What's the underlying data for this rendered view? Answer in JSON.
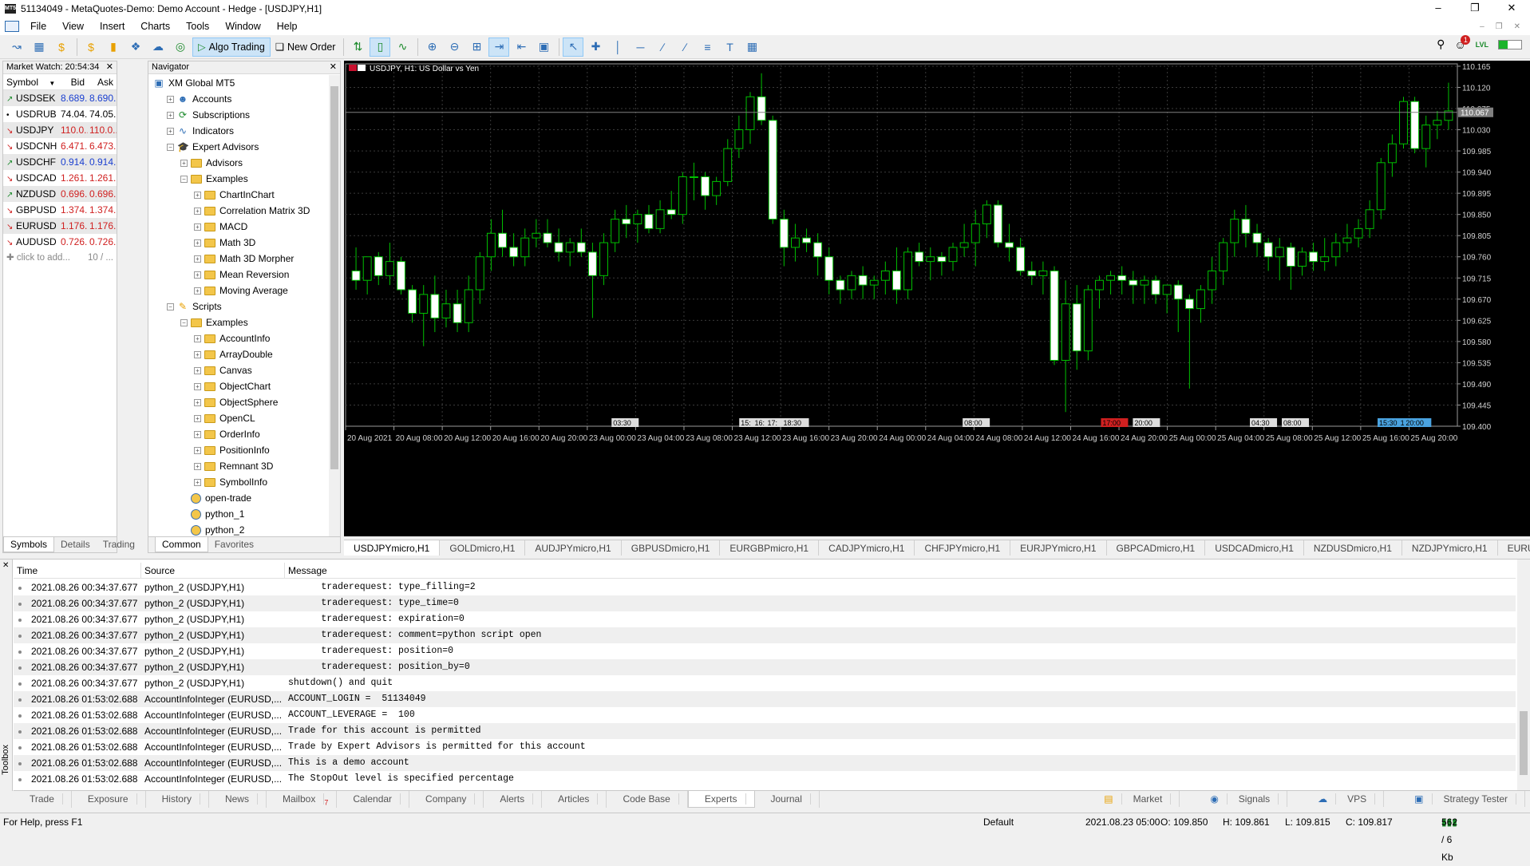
{
  "window": {
    "title": "51134049 - MetaQuotes-Demo: Demo Account - Hedge - [USDJPY,H1]",
    "app_icon": "MT5"
  },
  "menu": [
    "File",
    "View",
    "Insert",
    "Charts",
    "Tools",
    "Window",
    "Help"
  ],
  "toolbar": {
    "algo_trading": "Algo Trading",
    "new_order": "New Order",
    "notification_count": "1",
    "level_badge": "LVL"
  },
  "market_watch": {
    "title": "Market Watch: 20:54:34",
    "headers": {
      "symbol": "Symbol",
      "bid": "Bid",
      "ask": "Ask"
    },
    "rows": [
      {
        "symbol": "USDSEK",
        "bid": "8.689...",
        "ask": "8.690...",
        "dir": "up",
        "color": "blue"
      },
      {
        "symbol": "USDRUB",
        "bid": "74.04...",
        "ask": "74.05...",
        "dir": "flat",
        "color": "black"
      },
      {
        "symbol": "USDJPY",
        "bid": "110.0...",
        "ask": "110.0...",
        "dir": "down",
        "color": "red"
      },
      {
        "symbol": "USDCNH",
        "bid": "6.471...",
        "ask": "6.473...",
        "dir": "down",
        "color": "red"
      },
      {
        "symbol": "USDCHF",
        "bid": "0.914...",
        "ask": "0.914...",
        "dir": "up",
        "color": "blue"
      },
      {
        "symbol": "USDCAD",
        "bid": "1.261...",
        "ask": "1.261...",
        "dir": "down",
        "color": "red"
      },
      {
        "symbol": "NZDUSD",
        "bid": "0.696...",
        "ask": "0.696...",
        "dir": "up",
        "color": "red"
      },
      {
        "symbol": "GBPUSD",
        "bid": "1.374...",
        "ask": "1.374...",
        "dir": "down",
        "color": "red"
      },
      {
        "symbol": "EURUSD",
        "bid": "1.176...",
        "ask": "1.176...",
        "dir": "down",
        "color": "red"
      },
      {
        "symbol": "AUDUSD",
        "bid": "0.726...",
        "ask": "0.726...",
        "dir": "down",
        "color": "red"
      }
    ],
    "add_text": "click to add...",
    "count_text": "10 / ...",
    "tabs": [
      "Symbols",
      "Details",
      "Trading"
    ]
  },
  "navigator": {
    "title": "Navigator",
    "items": [
      {
        "label": "XM Global MT5",
        "level": 0,
        "kind": "root"
      },
      {
        "label": "Accounts",
        "level": 1,
        "kind": "accounts",
        "expander": "+"
      },
      {
        "label": "Subscriptions",
        "level": 1,
        "kind": "subs",
        "expander": "+"
      },
      {
        "label": "Indicators",
        "level": 1,
        "kind": "ind",
        "expander": "+"
      },
      {
        "label": "Expert Advisors",
        "level": 1,
        "kind": "ea",
        "expander": "-"
      },
      {
        "label": "Advisors",
        "level": 2,
        "kind": "folder",
        "expander": "+"
      },
      {
        "label": "Examples",
        "level": 2,
        "kind": "folder",
        "expander": "-"
      },
      {
        "label": "ChartInChart",
        "level": 3,
        "kind": "folder",
        "expander": "+"
      },
      {
        "label": "Correlation Matrix 3D",
        "level": 3,
        "kind": "folder",
        "expander": "+"
      },
      {
        "label": "MACD",
        "level": 3,
        "kind": "folder",
        "expander": "+"
      },
      {
        "label": "Math 3D",
        "level": 3,
        "kind": "folder",
        "expander": "+"
      },
      {
        "label": "Math 3D Morpher",
        "level": 3,
        "kind": "folder",
        "expander": "+"
      },
      {
        "label": "Mean Reversion",
        "level": 3,
        "kind": "folder",
        "expander": "+"
      },
      {
        "label": "Moving Average",
        "level": 3,
        "kind": "folder",
        "expander": "+"
      },
      {
        "label": "Scripts",
        "level": 1,
        "kind": "scripts",
        "expander": "-"
      },
      {
        "label": "Examples",
        "level": 2,
        "kind": "folder",
        "expander": "-"
      },
      {
        "label": "AccountInfo",
        "level": 3,
        "kind": "folder",
        "expander": "+"
      },
      {
        "label": "ArrayDouble",
        "level": 3,
        "kind": "folder",
        "expander": "+"
      },
      {
        "label": "Canvas",
        "level": 3,
        "kind": "folder",
        "expander": "+"
      },
      {
        "label": "ObjectChart",
        "level": 3,
        "kind": "folder",
        "expander": "+"
      },
      {
        "label": "ObjectSphere",
        "level": 3,
        "kind": "folder",
        "expander": "+"
      },
      {
        "label": "OpenCL",
        "level": 3,
        "kind": "folder",
        "expander": "+"
      },
      {
        "label": "OrderInfo",
        "level": 3,
        "kind": "folder",
        "expander": "+"
      },
      {
        "label": "PositionInfo",
        "level": 3,
        "kind": "folder",
        "expander": "+"
      },
      {
        "label": "Remnant 3D",
        "level": 3,
        "kind": "folder",
        "expander": "+"
      },
      {
        "label": "SymbolInfo",
        "level": 3,
        "kind": "folder",
        "expander": "+"
      },
      {
        "label": "open-trade",
        "level": 2,
        "kind": "python"
      },
      {
        "label": "python_1",
        "level": 2,
        "kind": "python"
      },
      {
        "label": "python_2",
        "level": 2,
        "kind": "python"
      }
    ],
    "tabs": [
      "Common",
      "Favorites"
    ]
  },
  "chart": {
    "label": "USDJPY, H1:  US Dollar vs Yen",
    "price_labels": [
      "110.165",
      "110.120",
      "110.075",
      "110.030",
      "109.985",
      "109.940",
      "109.895",
      "109.850",
      "109.805",
      "109.760",
      "109.715",
      "109.670",
      "109.625",
      "109.580",
      "109.535",
      "109.490",
      "109.445",
      "109.400"
    ],
    "current_price": "110.067",
    "time_labels": [
      "20 Aug 2021",
      "20 Aug 08:00",
      "20 Aug 12:00",
      "20 Aug 16:00",
      "20 Aug 20:00",
      "23 Aug 00:00",
      "23 Aug 04:00",
      "23 Aug 08:00",
      "23 Aug 12:00",
      "23 Aug 16:00",
      "23 Aug 20:00",
      "24 Aug 00:00",
      "24 Aug 04:00",
      "24 Aug 08:00",
      "24 Aug 12:00",
      "24 Aug 16:00",
      "24 Aug 20:00",
      "25 Aug 00:00",
      "25 Aug 04:00",
      "25 Aug 08:00",
      "25 Aug 12:00",
      "25 Aug 16:00",
      "25 Aug 20:00"
    ],
    "event_markers": [
      "03:30",
      "15:",
      "16:",
      "17:",
      "18:30",
      "08:00",
      "17:00",
      "20:00",
      "04:30",
      "08:00",
      "15:30",
      "17:30",
      "20:00"
    ]
  },
  "chart_data": {
    "type": "candlestick",
    "symbol": "USDJPY",
    "timeframe": "H1",
    "ylim": [
      109.4,
      110.17
    ],
    "candles": [
      [
        109.73,
        109.78,
        109.69,
        109.71
      ],
      [
        109.71,
        109.76,
        109.68,
        109.76
      ],
      [
        109.76,
        109.77,
        109.7,
        109.72
      ],
      [
        109.72,
        109.79,
        109.7,
        109.75
      ],
      [
        109.75,
        109.76,
        109.68,
        109.69
      ],
      [
        109.69,
        109.7,
        109.62,
        109.64
      ],
      [
        109.64,
        109.7,
        109.57,
        109.68
      ],
      [
        109.68,
        109.72,
        109.6,
        109.63
      ],
      [
        109.63,
        109.69,
        109.61,
        109.66
      ],
      [
        109.66,
        109.69,
        109.6,
        109.62
      ],
      [
        109.62,
        109.72,
        109.6,
        109.69
      ],
      [
        109.69,
        109.77,
        109.66,
        109.76
      ],
      [
        109.76,
        109.84,
        109.73,
        109.81
      ],
      [
        109.81,
        109.86,
        109.76,
        109.78
      ],
      [
        109.78,
        109.81,
        109.74,
        109.76
      ],
      [
        109.76,
        109.82,
        109.74,
        109.8
      ],
      [
        109.8,
        109.84,
        109.78,
        109.81
      ],
      [
        109.81,
        109.84,
        109.78,
        109.79
      ],
      [
        109.79,
        109.82,
        109.75,
        109.77
      ],
      [
        109.77,
        109.8,
        109.74,
        109.79
      ],
      [
        109.79,
        109.82,
        109.76,
        109.77
      ],
      [
        109.77,
        109.79,
        109.63,
        109.72
      ],
      [
        109.72,
        109.81,
        109.7,
        109.79
      ],
      [
        109.79,
        109.86,
        109.77,
        109.84
      ],
      [
        109.84,
        109.87,
        109.8,
        109.83
      ],
      [
        109.83,
        109.86,
        109.79,
        109.85
      ],
      [
        109.85,
        109.87,
        109.81,
        109.82
      ],
      [
        109.82,
        109.88,
        109.81,
        109.86
      ],
      [
        109.86,
        109.9,
        109.84,
        109.85
      ],
      [
        109.85,
        109.94,
        109.83,
        109.93
      ],
      [
        109.93,
        109.96,
        109.88,
        109.93
      ],
      [
        109.93,
        109.94,
        109.86,
        109.89
      ],
      [
        109.89,
        109.93,
        109.87,
        109.92
      ],
      [
        109.92,
        110.01,
        109.91,
        109.99
      ],
      [
        109.99,
        110.06,
        109.97,
        110.03
      ],
      [
        110.03,
        110.11,
        110.0,
        110.1
      ],
      [
        110.1,
        110.15,
        110.04,
        110.05
      ],
      [
        110.05,
        110.06,
        109.83,
        109.84
      ],
      [
        109.84,
        109.86,
        109.74,
        109.78
      ],
      [
        109.78,
        109.83,
        109.75,
        109.8
      ],
      [
        109.8,
        109.82,
        109.77,
        109.79
      ],
      [
        109.79,
        109.81,
        109.72,
        109.76
      ],
      [
        109.76,
        109.78,
        109.68,
        109.71
      ],
      [
        109.71,
        109.72,
        109.66,
        109.69
      ],
      [
        109.69,
        109.73,
        109.67,
        109.72
      ],
      [
        109.72,
        109.74,
        109.67,
        109.7
      ],
      [
        109.7,
        109.72,
        109.67,
        109.71
      ],
      [
        109.71,
        109.75,
        109.68,
        109.73
      ],
      [
        109.73,
        109.78,
        109.66,
        109.69
      ],
      [
        109.69,
        109.78,
        109.67,
        109.77
      ],
      [
        109.77,
        109.79,
        109.74,
        109.75
      ],
      [
        109.75,
        109.78,
        109.71,
        109.76
      ],
      [
        109.76,
        109.77,
        109.72,
        109.75
      ],
      [
        109.75,
        109.79,
        109.73,
        109.78
      ],
      [
        109.78,
        109.83,
        109.76,
        109.79
      ],
      [
        109.79,
        109.86,
        109.74,
        109.83
      ],
      [
        109.83,
        109.88,
        109.8,
        109.87
      ],
      [
        109.87,
        109.88,
        109.78,
        109.79
      ],
      [
        109.79,
        109.83,
        109.75,
        109.78
      ],
      [
        109.78,
        109.8,
        109.72,
        109.73
      ],
      [
        109.73,
        109.75,
        109.7,
        109.72
      ],
      [
        109.72,
        109.75,
        109.68,
        109.73
      ],
      [
        109.73,
        109.74,
        109.53,
        109.54
      ],
      [
        109.54,
        109.71,
        109.43,
        109.66
      ],
      [
        109.66,
        109.7,
        109.52,
        109.56
      ],
      [
        109.56,
        109.7,
        109.54,
        109.69
      ],
      [
        109.69,
        109.72,
        109.65,
        109.71
      ],
      [
        109.71,
        109.73,
        109.68,
        109.72
      ],
      [
        109.72,
        109.74,
        109.68,
        109.71
      ],
      [
        109.71,
        109.73,
        109.66,
        109.7
      ],
      [
        109.7,
        109.72,
        109.66,
        109.71
      ],
      [
        109.71,
        109.72,
        109.66,
        109.68
      ],
      [
        109.68,
        109.7,
        109.64,
        109.7
      ],
      [
        109.7,
        109.71,
        109.6,
        109.67
      ],
      [
        109.67,
        109.68,
        109.48,
        109.65
      ],
      [
        109.65,
        109.7,
        109.62,
        109.69
      ],
      [
        109.69,
        109.76,
        109.66,
        109.73
      ],
      [
        109.73,
        109.8,
        109.7,
        109.79
      ],
      [
        109.79,
        109.86,
        109.76,
        109.84
      ],
      [
        109.84,
        109.87,
        109.78,
        109.81
      ],
      [
        109.81,
        109.83,
        109.76,
        109.79
      ],
      [
        109.79,
        109.8,
        109.73,
        109.76
      ],
      [
        109.76,
        109.8,
        109.71,
        109.78
      ],
      [
        109.78,
        109.79,
        109.69,
        109.74
      ],
      [
        109.74,
        109.78,
        109.72,
        109.77
      ],
      [
        109.77,
        109.79,
        109.73,
        109.75
      ],
      [
        109.75,
        109.8,
        109.73,
        109.76
      ],
      [
        109.76,
        109.81,
        109.74,
        109.79
      ],
      [
        109.79,
        109.83,
        109.77,
        109.8
      ],
      [
        109.8,
        109.84,
        109.78,
        109.82
      ],
      [
        109.82,
        109.88,
        109.8,
        109.86
      ],
      [
        109.86,
        109.97,
        109.84,
        109.96
      ],
      [
        109.96,
        110.02,
        109.93,
        110.0
      ],
      [
        110.0,
        110.1,
        109.99,
        110.09
      ],
      [
        110.09,
        110.1,
        109.98,
        109.99
      ],
      [
        109.99,
        110.06,
        109.95,
        110.04
      ],
      [
        110.04,
        110.07,
        110.01,
        110.05
      ],
      [
        110.05,
        110.13,
        110.03,
        110.07
      ]
    ]
  },
  "symbol_tabs": [
    "USDJPYmicro,H1",
    "GOLDmicro,H1",
    "AUDJPYmicro,H1",
    "GBPUSDmicro,H1",
    "EURGBPmicro,H1",
    "CADJPYmicro,H1",
    "CHFJPYmicro,H1",
    "EURJPYmicro,H1",
    "GBPCADmicro,H1",
    "USDCADmicro,H1",
    "NZDUSDmicro,H1",
    "NZDJPYmicro,H1",
    "EURUSDmi"
  ],
  "toolbox": {
    "side_label": "Toolbox",
    "headers": {
      "time": "Time",
      "source": "Source",
      "message": "Message"
    },
    "rows": [
      {
        "time": "2021.08.26 00:34:37.677",
        "source": "python_2 (USDJPY,H1)",
        "message": "      traderequest: type_filling=2"
      },
      {
        "time": "2021.08.26 00:34:37.677",
        "source": "python_2 (USDJPY,H1)",
        "message": "      traderequest: type_time=0"
      },
      {
        "time": "2021.08.26 00:34:37.677",
        "source": "python_2 (USDJPY,H1)",
        "message": "      traderequest: expiration=0"
      },
      {
        "time": "2021.08.26 00:34:37.677",
        "source": "python_2 (USDJPY,H1)",
        "message": "      traderequest: comment=python script open"
      },
      {
        "time": "2021.08.26 00:34:37.677",
        "source": "python_2 (USDJPY,H1)",
        "message": "      traderequest: position=0"
      },
      {
        "time": "2021.08.26 00:34:37.677",
        "source": "python_2 (USDJPY,H1)",
        "message": "      traderequest: position_by=0"
      },
      {
        "time": "2021.08.26 00:34:37.677",
        "source": "python_2 (USDJPY,H1)",
        "message": "shutdown() and quit"
      },
      {
        "time": "2021.08.26 01:53:02.688",
        "source": "AccountInfoInteger (EURUSD,...",
        "message": "ACCOUNT_LOGIN =  51134049"
      },
      {
        "time": "2021.08.26 01:53:02.688",
        "source": "AccountInfoInteger (EURUSD,...",
        "message": "ACCOUNT_LEVERAGE =  100"
      },
      {
        "time": "2021.08.26 01:53:02.688",
        "source": "AccountInfoInteger (EURUSD,...",
        "message": "Trade for this account is permitted"
      },
      {
        "time": "2021.08.26 01:53:02.688",
        "source": "AccountInfoInteger (EURUSD,...",
        "message": "Trade by Expert Advisors is permitted for this account"
      },
      {
        "time": "2021.08.26 01:53:02.688",
        "source": "AccountInfoInteger (EURUSD,...",
        "message": "This is a demo account"
      },
      {
        "time": "2021.08.26 01:53:02.688",
        "source": "AccountInfoInteger (EURUSD,...",
        "message": "The StopOut level is specified percentage"
      }
    ],
    "tabs": [
      "Trade",
      "Exposure",
      "History",
      "News",
      "Mailbox",
      "Calendar",
      "Company",
      "Alerts",
      "Articles",
      "Code Base",
      "Experts",
      "Journal"
    ],
    "mailbox_badge": "7",
    "selected_tab": "Experts",
    "right_items": [
      "Market",
      "Signals",
      "VPS",
      "Strategy Tester"
    ]
  },
  "status": {
    "help": "For Help, press F1",
    "profile": "Default",
    "datetime": "2021.08.23 05:00",
    "open": "O: 109.850",
    "high": "H: 109.861",
    "low": "L: 109.815",
    "close": "C: 109.817",
    "traffic": "562 / 6 Kb"
  },
  "colors": {
    "bull": "#ffffff",
    "bear": "#ffffff",
    "wick": "#00c000",
    "grid": "#3a3a3a",
    "accent": "#2d6db5"
  }
}
